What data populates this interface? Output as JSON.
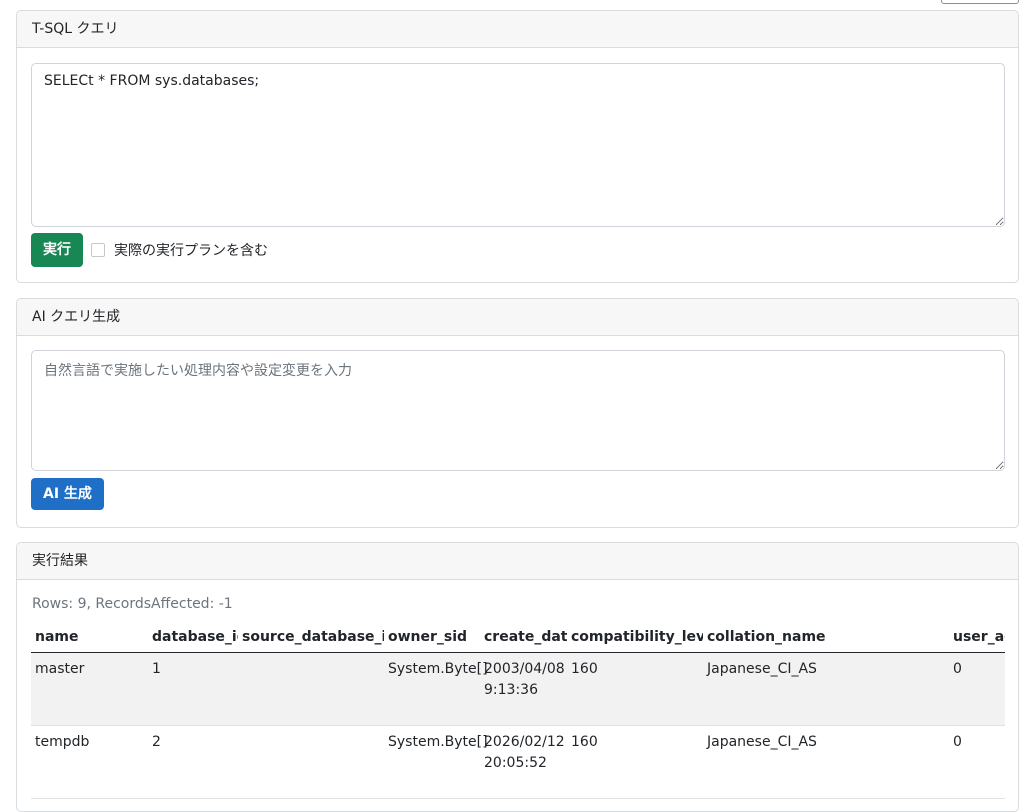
{
  "tsql_card": {
    "title": "T-SQL クエリ",
    "query": "SELECt * FROM sys.databases;",
    "run_label": "実行",
    "include_plan_label": "実際の実行プランを含む"
  },
  "ai_card": {
    "title": "AI クエリ生成",
    "placeholder": "自然言語で実施したい処理内容や設定変更を入力",
    "generate_label": "AI 生成"
  },
  "result_card": {
    "title": "実行結果",
    "summary": "Rows: 9, RecordsAffected: -1",
    "columns": [
      "name",
      "database_id",
      "source_database_id",
      "owner_sid",
      "create_date",
      "compatibility_level",
      "collation_name",
      "user_ac"
    ],
    "rows": [
      {
        "name": "master",
        "database_id": "1",
        "source_database_id": "",
        "owner_sid": "System.Byte[]",
        "create_date_1": "2003/04/08",
        "create_date_2": "9:13:36",
        "compatibility_level": "160",
        "collation_name": "Japanese_CI_AS",
        "user_ac": "0"
      },
      {
        "name": "tempdb",
        "database_id": "2",
        "source_database_id": "",
        "owner_sid": "System.Byte[]",
        "create_date_1": "2026/02/12",
        "create_date_2": "20:05:52",
        "compatibility_level": "160",
        "collation_name": "Japanese_CI_AS",
        "user_ac": "0"
      }
    ]
  }
}
